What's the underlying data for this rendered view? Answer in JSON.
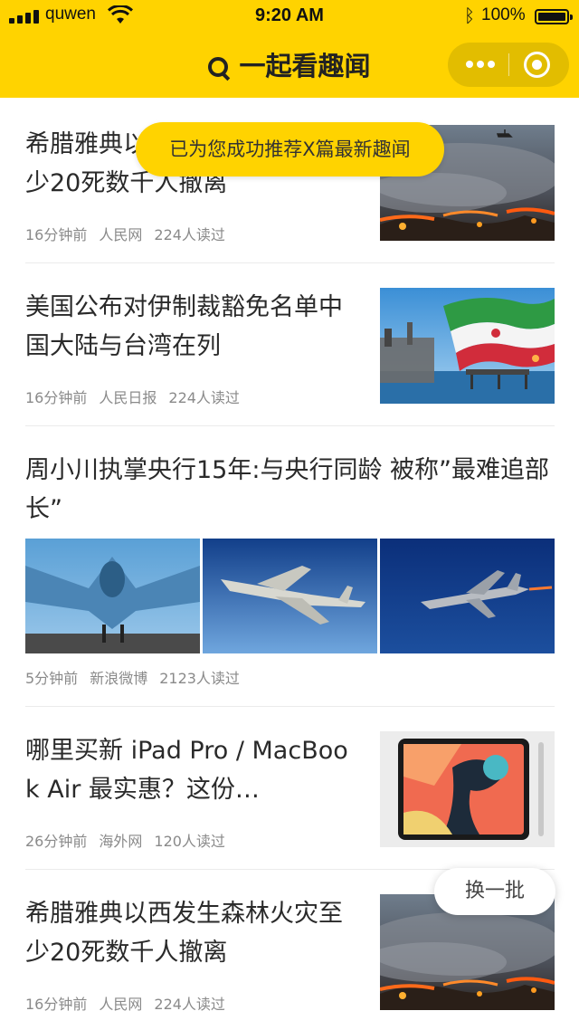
{
  "status_bar": {
    "carrier": "quwen",
    "time": "9:20 AM",
    "battery_text": "100%",
    "battery_level": 1.0
  },
  "header": {
    "title": "一起看趣闻"
  },
  "toast": {
    "text": "已为您成功推荐X篇最新趣闻"
  },
  "articles": [
    {
      "title": "希腊雅典以西发生森林火灾至少20死数千人撤离",
      "time": "16分钟前",
      "source": "人民网",
      "reads": "224人读过",
      "image": "wildfire-photo"
    },
    {
      "title": "美国公布对伊制裁豁免名单中国大陆与台湾在列",
      "time": "16分钟前",
      "source": "人民日报",
      "reads": "224人读过",
      "image": "iran-flag-oil-rig-photo"
    },
    {
      "title": "周小川执掌央行15年:与央行同龄 被称”最难追部长”",
      "time": "5分钟前",
      "source": "新浪微博",
      "reads": "2123人读过",
      "images": [
        "stealth-fighter-photo",
        "f14-jet-photo",
        "f16-jet-photo"
      ]
    },
    {
      "title": "哪里买新 iPad Pro / MacBook Air 最实惠？这份…",
      "time": "26分钟前",
      "source": "海外网",
      "reads": "120人读过",
      "image": "ipad-pro-photo"
    },
    {
      "title": "希腊雅典以西发生森林火灾至少20死数千人撤离",
      "time": "16分钟前",
      "source": "人民网",
      "reads": "224人读过",
      "image": "wildfire-photo"
    }
  ],
  "refresh_button": {
    "label": "换一批"
  },
  "colors": {
    "brand_yellow": "#FFD300",
    "capsule_yellow": "#E2BD00",
    "meta_gray": "#8a8a8a"
  }
}
